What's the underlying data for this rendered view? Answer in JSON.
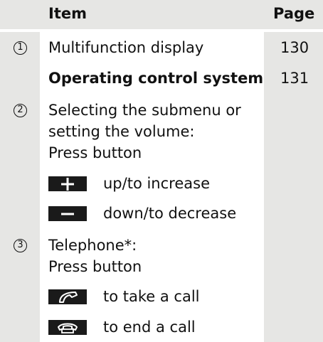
{
  "header": {
    "item": "Item",
    "page": "Page"
  },
  "rows": [
    {
      "num": "1",
      "text": "Multifunction display",
      "page": "130"
    },
    {
      "text": "Operating control system",
      "page": "131"
    },
    {
      "num": "2",
      "lines": [
        "Selecting the submenu or",
        "setting the volume:",
        "Press button"
      ]
    },
    {
      "sub": "up/to increase",
      "icon": "plus-icon"
    },
    {
      "sub": "down/to decrease",
      "icon": "minus-icon"
    },
    {
      "num": "3",
      "lines": [
        "Telephone*:",
        "Press button"
      ]
    },
    {
      "sub": "to take a call",
      "icon": "phone-pickup-icon"
    },
    {
      "sub": "to end a call",
      "icon": "phone-hangup-icon"
    }
  ],
  "colors": {
    "shade": "#e6e6e4",
    "key": "#1a1a1a"
  }
}
